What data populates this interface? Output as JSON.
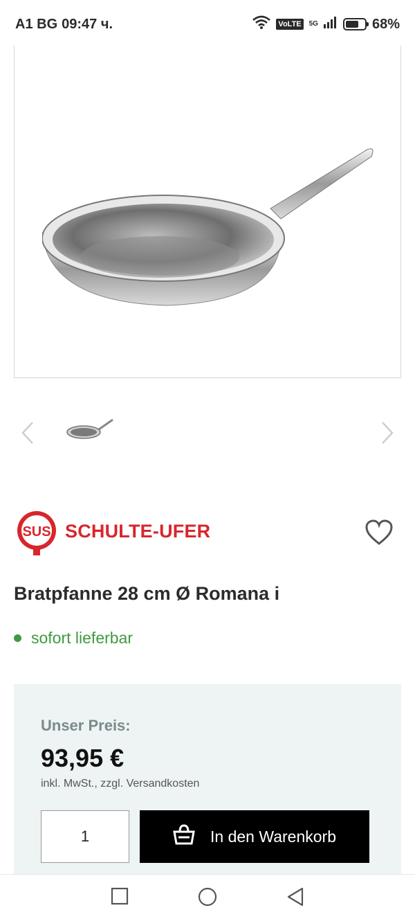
{
  "status_bar": {
    "carrier": "A1 BG",
    "time": "09:47 ч.",
    "network_badge": "VoLTE",
    "network_type": "5G",
    "battery_percent": "68%",
    "battery_level": 0.68
  },
  "gallery": {
    "prev_icon": "chevron-left-icon",
    "next_icon": "chevron-right-icon"
  },
  "brand": {
    "logo_text": "SUS",
    "name": "SCHULTE-UFER",
    "color": "#d8262c"
  },
  "product": {
    "title": "Bratpfanne 28 cm Ø Romana i",
    "availability": "sofort lieferbar",
    "availability_color": "#3f9a3f"
  },
  "pricing": {
    "label": "Unser Preis:",
    "price": "93,95 €",
    "tax_note": "inkl. MwSt., zzgl. Versandkosten",
    "quantity": "1",
    "add_to_cart_label": "In den Warenkorb"
  },
  "nav": {
    "icons": [
      "recent-apps-icon",
      "home-icon",
      "back-icon"
    ]
  }
}
